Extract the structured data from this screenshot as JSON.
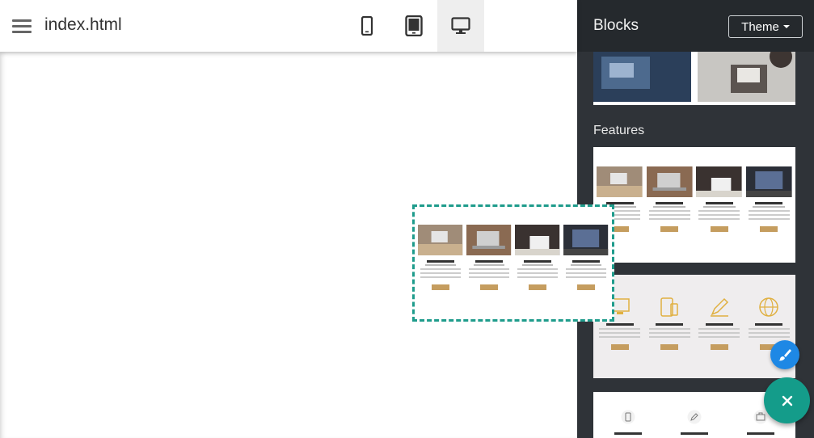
{
  "header": {
    "filename": "index.html",
    "devices": [
      {
        "name": "mobile",
        "active": false
      },
      {
        "name": "tablet",
        "active": false
      },
      {
        "name": "desktop",
        "active": true
      }
    ]
  },
  "sidebar": {
    "title": "Blocks",
    "theme_label": "Theme",
    "section_label": "Features"
  },
  "colors": {
    "accent": "#149c8a",
    "blue": "#1e88e5",
    "sidebar_bg": "#2f3338",
    "button_tan": "#c59d5f"
  },
  "fab": {
    "close_icon": "close-icon",
    "brush_icon": "brush-icon"
  }
}
